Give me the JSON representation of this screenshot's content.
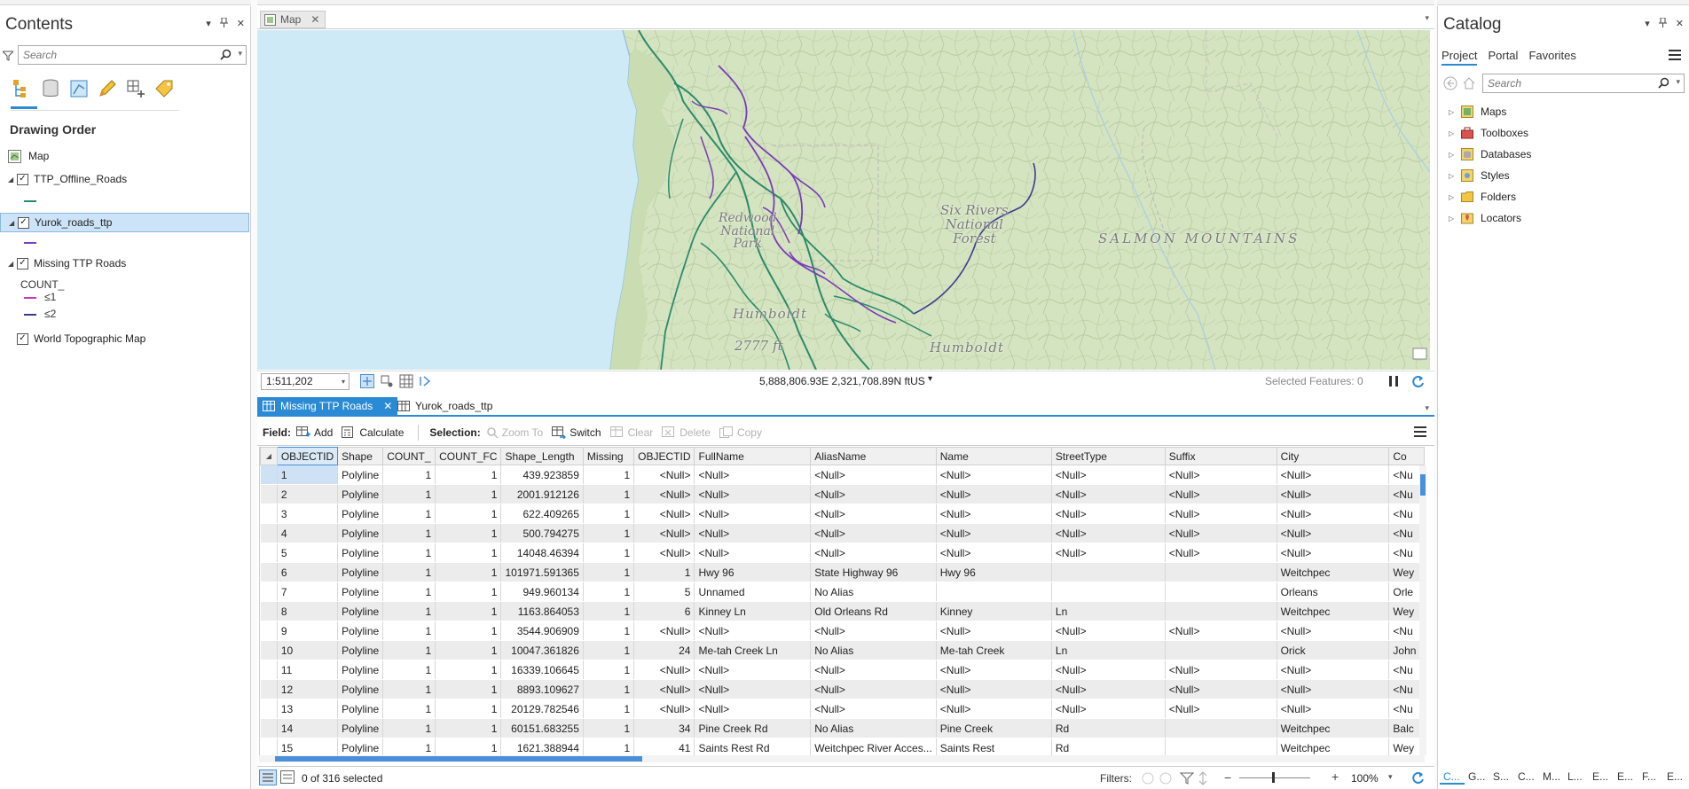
{
  "contents": {
    "title": "Contents",
    "search_placeholder": "Search",
    "drawing_order": "Drawing Order",
    "map_name": "Map",
    "layers": [
      {
        "name": "TTP_Offline_Roads",
        "checked": true,
        "selected": false
      },
      {
        "name": "Yurok_roads_ttp",
        "checked": true,
        "selected": true
      },
      {
        "name": "Missing TTP Roads",
        "checked": true,
        "selected": false
      },
      {
        "name": "World Topographic Map",
        "checked": true,
        "selected": false
      }
    ],
    "legend_field": "COUNT_",
    "legend_classes": [
      "≤1",
      "≤2"
    ],
    "colors": {
      "teal": "#2b8a6a",
      "purple": "#7a3bb8",
      "magenta": "#c733c9",
      "navy": "#3a3d8f"
    }
  },
  "map": {
    "tab_label": "Map",
    "scale": "1:511,202",
    "coordinates": "5,888,806.93E 2,321,708.89N ftUS",
    "selected_features": "Selected Features: 0",
    "labels": {
      "redwood": "Redwood\nNational\nPark",
      "six_rivers": "Six Rivers\nNational\nForest",
      "salmon": "SALMON MOUNTAINS",
      "humboldt1": "Humboldt",
      "humboldt2": "Humboldt",
      "elevation": "2777 ft"
    }
  },
  "table": {
    "tabs": [
      "Missing TTP Roads",
      "Yurok_roads_ttp"
    ],
    "toolbar": {
      "field_label": "Field:",
      "add": "Add",
      "calculate": "Calculate",
      "selection_label": "Selection:",
      "zoom_to": "Zoom To",
      "switch": "Switch",
      "clear": "Clear",
      "delete": "Delete",
      "copy": "Copy"
    },
    "columns": [
      "OBJECTID",
      "Shape",
      "COUNT_",
      "COUNT_FC",
      "Shape_Length",
      "Missing",
      "OBJECTID",
      "FullName",
      "AliasName",
      "Name",
      "StreetType",
      "Suffix",
      "City",
      "Co"
    ],
    "rows": [
      [
        "1",
        "Polyline",
        "1",
        "1",
        "439.923859",
        "1",
        "<Null>",
        "<Null>",
        "<Null>",
        "<Null>",
        "<Null>",
        "<Null>",
        "<Null>",
        "<Nu"
      ],
      [
        "2",
        "Polyline",
        "1",
        "1",
        "2001.912126",
        "1",
        "<Null>",
        "<Null>",
        "<Null>",
        "<Null>",
        "<Null>",
        "<Null>",
        "<Null>",
        "<Nu"
      ],
      [
        "3",
        "Polyline",
        "1",
        "1",
        "622.409265",
        "1",
        "<Null>",
        "<Null>",
        "<Null>",
        "<Null>",
        "<Null>",
        "<Null>",
        "<Null>",
        "<Nu"
      ],
      [
        "4",
        "Polyline",
        "1",
        "1",
        "500.794275",
        "1",
        "<Null>",
        "<Null>",
        "<Null>",
        "<Null>",
        "<Null>",
        "<Null>",
        "<Null>",
        "<Nu"
      ],
      [
        "5",
        "Polyline",
        "1",
        "1",
        "14048.46394",
        "1",
        "<Null>",
        "<Null>",
        "<Null>",
        "<Null>",
        "<Null>",
        "<Null>",
        "<Null>",
        "<Nu"
      ],
      [
        "6",
        "Polyline",
        "1",
        "1",
        "101971.591365",
        "1",
        "1",
        "Hwy 96",
        "State Highway 96",
        "Hwy 96",
        "",
        "",
        "Weitchpec",
        "Wey"
      ],
      [
        "7",
        "Polyline",
        "1",
        "1",
        "949.960134",
        "1",
        "5",
        "Unnamed",
        "No Alias",
        "",
        "",
        "",
        "Orleans",
        "Orle"
      ],
      [
        "8",
        "Polyline",
        "1",
        "1",
        "1163.864053",
        "1",
        "6",
        "Kinney Ln",
        "Old Orleans Rd",
        "Kinney",
        "Ln",
        "",
        "Weitchpec",
        "Wey"
      ],
      [
        "9",
        "Polyline",
        "1",
        "1",
        "3544.906909",
        "1",
        "<Null>",
        "<Null>",
        "<Null>",
        "<Null>",
        "<Null>",
        "<Null>",
        "<Null>",
        "<Nu"
      ],
      [
        "10",
        "Polyline",
        "1",
        "1",
        "10047.361826",
        "1",
        "24",
        "Me-tah Creek Ln",
        "No Alias",
        "Me-tah Creek",
        "Ln",
        "",
        "Orick",
        "John"
      ],
      [
        "11",
        "Polyline",
        "1",
        "1",
        "16339.106645",
        "1",
        "<Null>",
        "<Null>",
        "<Null>",
        "<Null>",
        "<Null>",
        "<Null>",
        "<Null>",
        "<Nu"
      ],
      [
        "12",
        "Polyline",
        "1",
        "1",
        "8893.109627",
        "1",
        "<Null>",
        "<Null>",
        "<Null>",
        "<Null>",
        "<Null>",
        "<Null>",
        "<Null>",
        "<Nu"
      ],
      [
        "13",
        "Polyline",
        "1",
        "1",
        "20129.782546",
        "1",
        "<Null>",
        "<Null>",
        "<Null>",
        "<Null>",
        "<Null>",
        "<Null>",
        "<Null>",
        "<Nu"
      ],
      [
        "14",
        "Polyline",
        "1",
        "1",
        "60151.683255",
        "1",
        "34",
        "Pine Creek Rd",
        "No Alias",
        "Pine Creek",
        "Rd",
        "",
        "Weitchpec",
        "Balc"
      ],
      [
        "15",
        "Polyline",
        "1",
        "1",
        "1621.388944",
        "1",
        "41",
        "Saints Rest Rd",
        "Weitchpec River Acces...",
        "Saints Rest",
        "Rd",
        "",
        "Weitchpec",
        "Wey"
      ]
    ],
    "selected_count": "0 of 316 selected",
    "filters_label": "Filters:",
    "zoom": "100%"
  },
  "catalog": {
    "title": "Catalog",
    "tabs": [
      "Project",
      "Portal",
      "Favorites"
    ],
    "search_placeholder": "Search",
    "items": [
      "Maps",
      "Toolboxes",
      "Databases",
      "Styles",
      "Folders",
      "Locators"
    ],
    "bottom_tabs": [
      "C...",
      "G...",
      "S...",
      "C...",
      "M...",
      "L...",
      "E...",
      "E...",
      "F...",
      "E..."
    ]
  }
}
